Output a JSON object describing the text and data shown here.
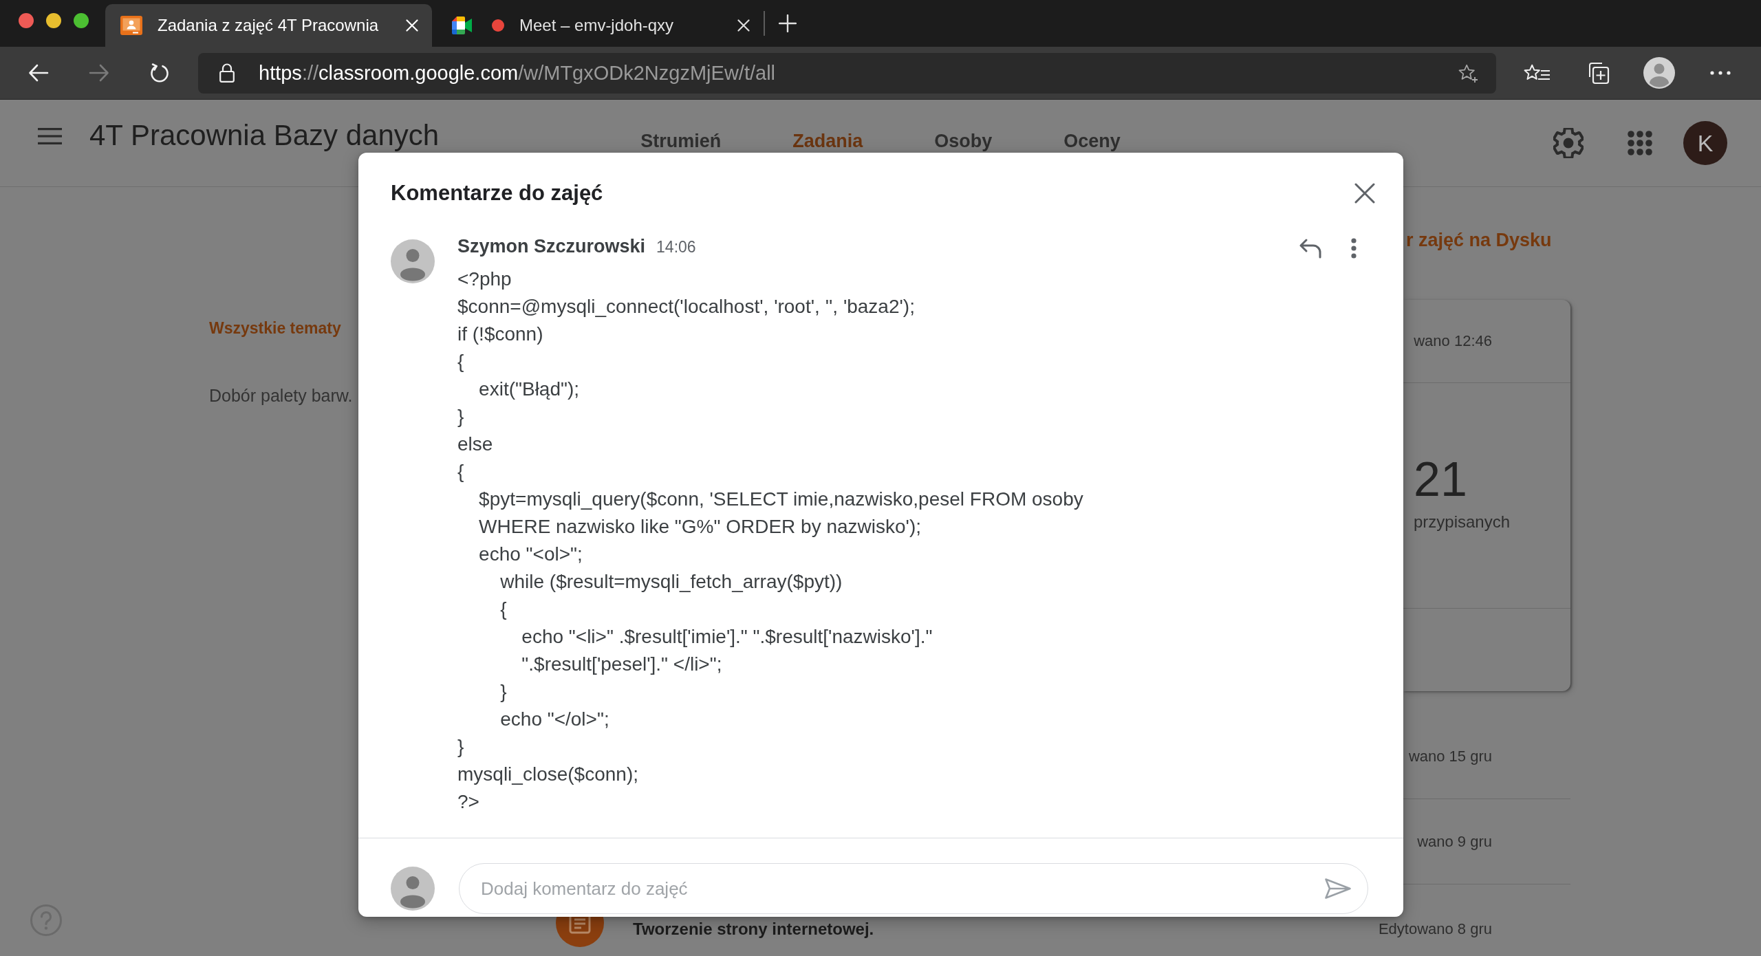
{
  "browser": {
    "tabs": [
      {
        "kind": "classroom",
        "title": "Zadania z zajęć 4T Pracownia",
        "selected": true,
        "recording": false
      },
      {
        "kind": "meet",
        "title": "Meet – emv-jdoh-qxy",
        "selected": false,
        "recording": true
      }
    ],
    "nav": [
      {
        "kind": "back",
        "disabled": false
      },
      {
        "kind": "forward",
        "disabled": true
      },
      {
        "kind": "reload",
        "disabled": false
      }
    ],
    "address": [
      {
        "text": "https",
        "emphasis": true
      },
      {
        "text": "://",
        "emphasis": false
      },
      {
        "text": "classroom.google.com",
        "emphasis": true
      },
      {
        "text": "/w/MTgxODk2NzgzMjEw/t/all",
        "emphasis": false
      }
    ]
  },
  "header": {
    "title": "4T Pracownia Bazy danych",
    "tabs": [
      {
        "label": "Strumień",
        "selected": false
      },
      {
        "label": "Zadania",
        "selected": true
      },
      {
        "label": "Osoby",
        "selected": false
      },
      {
        "label": "Oceny",
        "selected": false
      }
    ],
    "account_initial": "K"
  },
  "topics": [
    {
      "label": "Wszystkie tematy",
      "selected": true
    },
    {
      "label": "Dobór palety barw.",
      "selected": false
    }
  ],
  "drive_link": "r zajęć na Dysku",
  "assignment_card": {
    "edited": "wano 12:46",
    "count": "21",
    "count_label": "przypisanych"
  },
  "assignment_rows": [
    {
      "edited": "wano 15 gru"
    },
    {
      "edited": "wano 9 gru"
    }
  ],
  "last_assignment": {
    "title": "Tworzenie strony internetowej.",
    "edited": "Edytowano 8 gru"
  },
  "dialog": {
    "title": "Komentarze do zajęć",
    "comments": [
      {
        "author": "Szymon Szczurowski",
        "time": "14:06",
        "text": "<?php\n$conn=@mysqli_connect('localhost', 'root', '', 'baza2');\nif (!$conn)\n{\n    exit(\"Błąd\");\n}\nelse\n{\n    $pyt=mysqli_query($conn, 'SELECT imie,nazwisko,pesel FROM osoby\n    WHERE nazwisko like \"G%\" ORDER by nazwisko');\n    echo \"<ol>\";\n        while ($result=mysqli_fetch_array($pyt))\n        {\n            echo \"<li>\" .$result['imie'].\" \".$result['nazwisko'].\"\n            \".$result['pesel'].\" </li>\";\n        }\n        echo \"</ol>\";\n}\nmysqli_close($conn);\n?>"
      }
    ],
    "composer": {
      "placeholder": "Dodaj komentarz do zajęć"
    }
  }
}
